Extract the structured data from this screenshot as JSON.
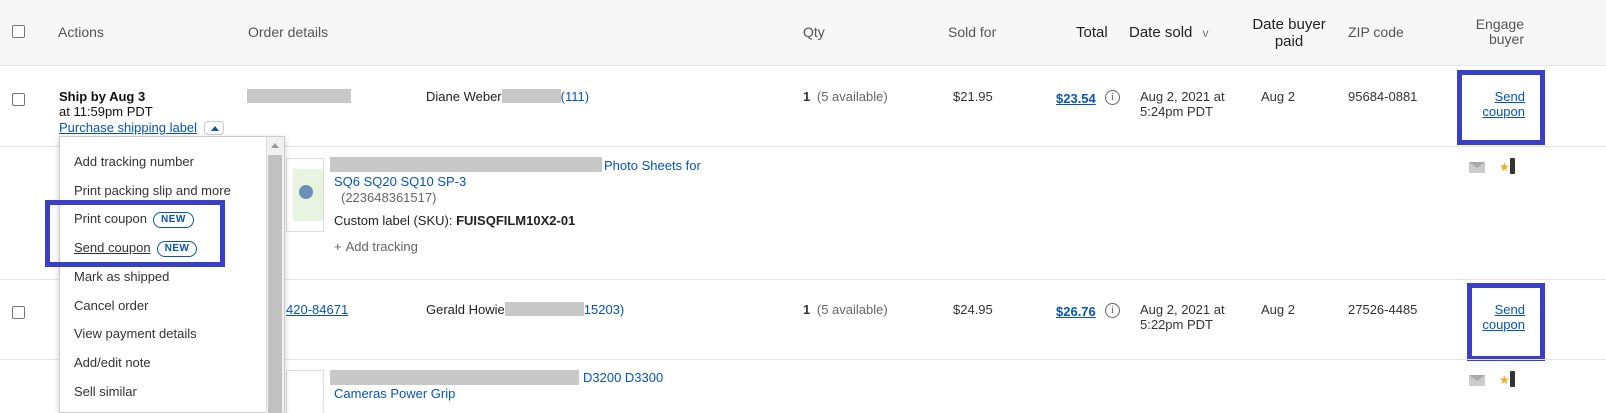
{
  "header": {
    "actions": "Actions",
    "order_details": "Order details",
    "qty": "Qty",
    "sold_for": "Sold for",
    "total": "Total",
    "date_sold": "Date sold",
    "sort_glyph": "v",
    "date_buyer_paid_1": "Date buyer",
    "date_buyer_paid_2": "paid",
    "zip_code": "ZIP code",
    "engage_buyer_1": "Engage",
    "engage_buyer_2": "buyer"
  },
  "row1": {
    "ship_by": "Ship by Aug 3",
    "ship_time": "at 11:59pm PDT",
    "purchase_label": "Purchase shipping label",
    "buyer_name": "Diane Weber",
    "buyer_feedback": "(111)",
    "qty": "1",
    "qty_available": "(5 available)",
    "sold_for": "$21.95",
    "total": "$23.54",
    "date_sold_1": "Aug 2, 2021 at",
    "date_sold_2": "5:24pm PDT",
    "date_paid": "Aug 2",
    "zip": "95684-0881",
    "send_coupon_1": "Send",
    "send_coupon_2": "coupon",
    "item_title_tail": "Photo Sheets for",
    "item_title_2": "SQ6 SQ20 SQ10 SP-3",
    "item_id": "(223648361517)",
    "custom_label_prefix": "Custom label (SKU): ",
    "custom_label_value": "FUISQFILM10X2-01",
    "add_tracking": "Add tracking"
  },
  "row2": {
    "order_number_tail": "420-84671",
    "buyer_name": "Gerald Howie",
    "buyer_feedback_tail": "15203)",
    "qty": "1",
    "qty_available": "(5 available)",
    "sold_for": "$24.95",
    "total": "$26.76",
    "date_sold_1": "Aug 2, 2021 at",
    "date_sold_2": "5:22pm PDT",
    "date_paid": "Aug 2",
    "zip": "27526-4485",
    "send_coupon_1": "Send",
    "send_coupon_2": "coupon",
    "item_title_tail": "D3200 D3300",
    "item_title_2": "Cameras Power Grip"
  },
  "menu": {
    "items": [
      "Add tracking number",
      "Print packing slip and more",
      "Print coupon",
      "Send coupon",
      "Mark as shipped",
      "Cancel order",
      "View payment details",
      "Add/edit note",
      "Sell similar"
    ],
    "badge": "NEW"
  },
  "info_glyph": "i",
  "star_glyph": "★",
  "plus_glyph": "+",
  "colors": {
    "link": "#0654ba",
    "highlight": "#3a3fc7",
    "redaction": "#c8c8c8"
  }
}
